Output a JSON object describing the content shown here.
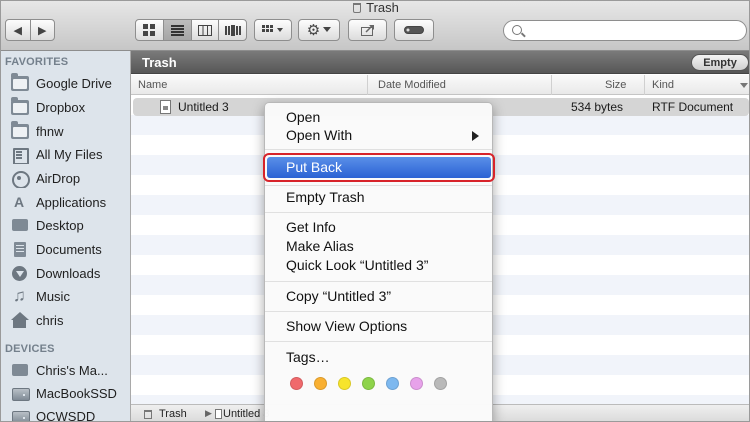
{
  "window": {
    "title": "Trash"
  },
  "toolbar": {
    "search_placeholder": "",
    "view_icons": [
      "icon-view-icon",
      "list-view-icon",
      "column-view-icon",
      "cover-flow-icon"
    ],
    "arrange_icon": "arrange-icon",
    "action_icon": "gear-icon",
    "share_icon": "share-icon",
    "tag_icon": "tag-icon"
  },
  "sidebar": {
    "favorites_header": "FAVORITES",
    "favorites": [
      {
        "label": "Google Drive",
        "icon": "folder-icon"
      },
      {
        "label": "Dropbox",
        "icon": "folder-icon"
      },
      {
        "label": "fhnw",
        "icon": "folder-icon"
      },
      {
        "label": "All My Files",
        "icon": "all-files-icon"
      },
      {
        "label": "AirDrop",
        "icon": "airdrop-icon"
      },
      {
        "label": "Applications",
        "icon": "applications-icon"
      },
      {
        "label": "Desktop",
        "icon": "desktop-icon"
      },
      {
        "label": "Documents",
        "icon": "documents-icon"
      },
      {
        "label": "Downloads",
        "icon": "downloads-icon"
      },
      {
        "label": "Music",
        "icon": "music-icon"
      },
      {
        "label": "chris",
        "icon": "home-icon"
      }
    ],
    "devices_header": "DEVICES",
    "devices": [
      {
        "label": "Chris's Ma...",
        "icon": "computer-icon"
      },
      {
        "label": "MacBookSSD",
        "icon": "disk-icon"
      },
      {
        "label": "OCWSDD",
        "icon": "disk-icon"
      }
    ]
  },
  "content": {
    "path_title": "Trash",
    "empty_button": "Empty",
    "columns": {
      "name": "Name",
      "date_modified": "Date Modified",
      "size": "Size",
      "kind": "Kind"
    },
    "file": {
      "name": "Untitled 3",
      "size": "534 bytes",
      "kind": "RTF Document"
    },
    "bottom_path": {
      "root": "Trash",
      "file": "Untitled 3"
    }
  },
  "context_menu": {
    "items": {
      "open": "Open",
      "open_with": "Open With",
      "put_back": "Put Back",
      "empty_trash": "Empty Trash",
      "get_info": "Get Info",
      "make_alias": "Make Alias",
      "quick_look": "Quick Look “Untitled 3”",
      "copy": "Copy “Untitled 3”",
      "show_view_options": "Show View Options",
      "tags": "Tags…"
    },
    "tag_colors": [
      "#f0696c",
      "#f9b032",
      "#f7e42b",
      "#8ed34a",
      "#7db8ef",
      "#e7a2ea",
      "#b9b9b9"
    ],
    "highlight_color": "#d8232a"
  }
}
